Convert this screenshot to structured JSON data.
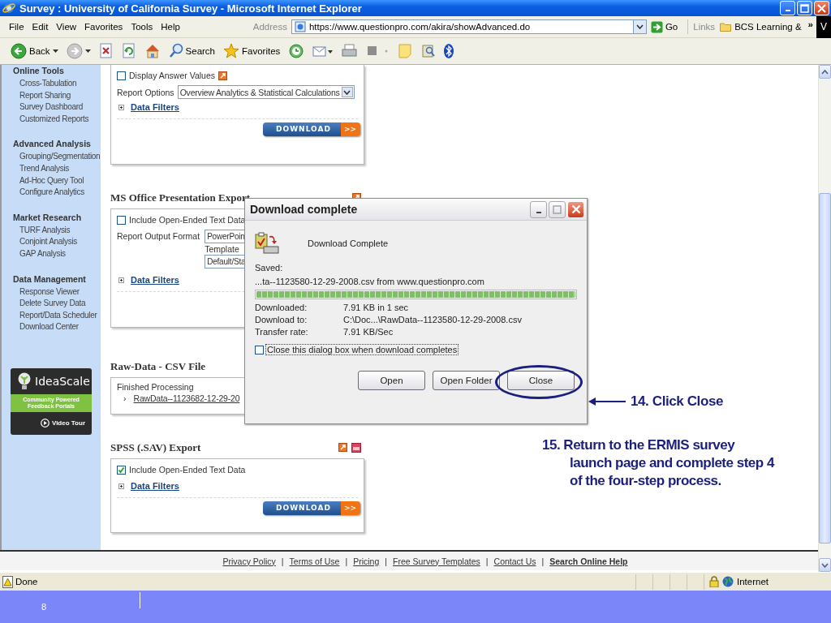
{
  "window": {
    "title": "Survey : University of California Survey - Microsoft Internet Explorer"
  },
  "menu": [
    "File",
    "Edit",
    "View",
    "Favorites",
    "Tools",
    "Help"
  ],
  "address": {
    "label": "Address",
    "value": "https://www.questionpro.com/akira/showAdvanced.do",
    "go": "Go"
  },
  "links": {
    "label": "Links",
    "item": "BCS Learning &",
    "more": "»",
    "edge": "V"
  },
  "toolbar": [
    {
      "kind": "back",
      "label": "Back"
    },
    {
      "kind": "forward"
    },
    {
      "kind": "stop"
    },
    {
      "kind": "refresh"
    },
    {
      "kind": "home"
    },
    {
      "kind": "search",
      "label": "Search"
    },
    {
      "kind": "favorites",
      "label": "Favorites"
    },
    {
      "kind": "history"
    },
    {
      "kind": "mail"
    },
    {
      "kind": "print"
    },
    {
      "kind": "edit"
    },
    {
      "kind": "notes"
    },
    {
      "kind": "research"
    },
    {
      "kind": "bluetooth"
    }
  ],
  "sidebar": {
    "sections": [
      {
        "heading": "Online Tools",
        "items": [
          "Cross-Tabulation",
          "Report Sharing",
          "Survey Dashboard",
          "Customized Reports"
        ]
      },
      {
        "heading": "Advanced Analysis",
        "items": [
          "Grouping/Segmentation",
          "Trend Analysis",
          "Ad-Hoc Query Tool",
          "Configure Analytics"
        ]
      },
      {
        "heading": "Market Research",
        "items": [
          "TURF Analysis",
          "Conjoint Analysis",
          "GAP Analysis"
        ]
      },
      {
        "heading": "Data Management",
        "items": [
          "Response Viewer",
          "Delete Survey Data",
          "Report/Data Scheduler",
          "Download Center"
        ]
      }
    ],
    "ad": {
      "brand": "IdeaScale",
      "tagline": "Community Powered Feedback Portals",
      "action": "Video Tour"
    }
  },
  "panels": [
    {
      "rows": [
        {
          "kind": "checkbox",
          "label": "Display Answer Values",
          "checked": false
        },
        {
          "kind": "select",
          "label": "Report Options",
          "value": "Overview Analytics & Statistical Calculations"
        },
        {
          "kind": "filters",
          "label": "Data Filters"
        },
        {
          "kind": "download",
          "label": "DOWNLOAD",
          "more": ">>"
        }
      ]
    },
    {
      "title": "MS Office Presentation Export",
      "rows": [
        {
          "kind": "checkbox",
          "label": "Include Open-Ended Text Data",
          "checked": false
        },
        {
          "kind": "format",
          "label": "Report Output Format",
          "value": "PowerPoin",
          "sublabel": "Template",
          "subvalue": "Default/Sta"
        },
        {
          "kind": "filters",
          "label": "Data Filters"
        }
      ]
    },
    {
      "title": "Raw-Data - CSV File",
      "rows": [
        {
          "kind": "text",
          "text": "Finished Processing"
        },
        {
          "kind": "file",
          "bullet": "›",
          "label": "RawData--1123682-12-29-20"
        }
      ]
    },
    {
      "title": "SPSS (.SAV) Export",
      "rows": [
        {
          "kind": "checkbox",
          "label": "Include Open-Ended Text Data",
          "checked": true
        },
        {
          "kind": "filters",
          "label": "Data Filters"
        },
        {
          "kind": "download",
          "label": "DOWNLOAD",
          "more": ">>"
        }
      ]
    }
  ],
  "dialog": {
    "title": "Download complete",
    "heading": "Download Complete",
    "saved_label": "Saved:",
    "saved": "...ta--1123580-12-29-2008.csv from www.questionpro.com",
    "progress": {
      "level": 1
    },
    "details": [
      {
        "label": "Downloaded:",
        "value": "7.91 KB in 1 sec"
      },
      {
        "label": "Download to:",
        "value": "C:\\Doc...\\RawData--1123580-12-29-2008.csv"
      },
      {
        "label": "Transfer rate:",
        "value": "7.91 KB/Sec"
      }
    ],
    "auto_close": {
      "label": "Close this dialog box when download completes",
      "checked": false
    },
    "buttons": [
      {
        "label": "Open",
        "circled": false
      },
      {
        "label": "Open Folder",
        "circled": false
      },
      {
        "label": "Close",
        "circled": true
      }
    ]
  },
  "annotations": [
    {
      "kind": "callout",
      "text": "14. Click Close"
    },
    {
      "kind": "note",
      "lines": [
        "15. Return to the ERMIS survey",
        "launch page and complete step 4",
        "of the four-step process."
      ]
    }
  ],
  "footer": {
    "separator": "|",
    "links": [
      {
        "label": "Privacy Policy",
        "bold": false
      },
      {
        "label": "Terms of Use",
        "bold": false
      },
      {
        "label": "Pricing",
        "bold": false
      },
      {
        "label": "Free Survey Templates",
        "bold": false
      },
      {
        "label": "Contact Us",
        "bold": false
      },
      {
        "label": "Search Online Help",
        "bold": true
      }
    ]
  },
  "status_bar": {
    "text": "Done",
    "zone": "Internet"
  },
  "slide": {
    "number": "8"
  }
}
